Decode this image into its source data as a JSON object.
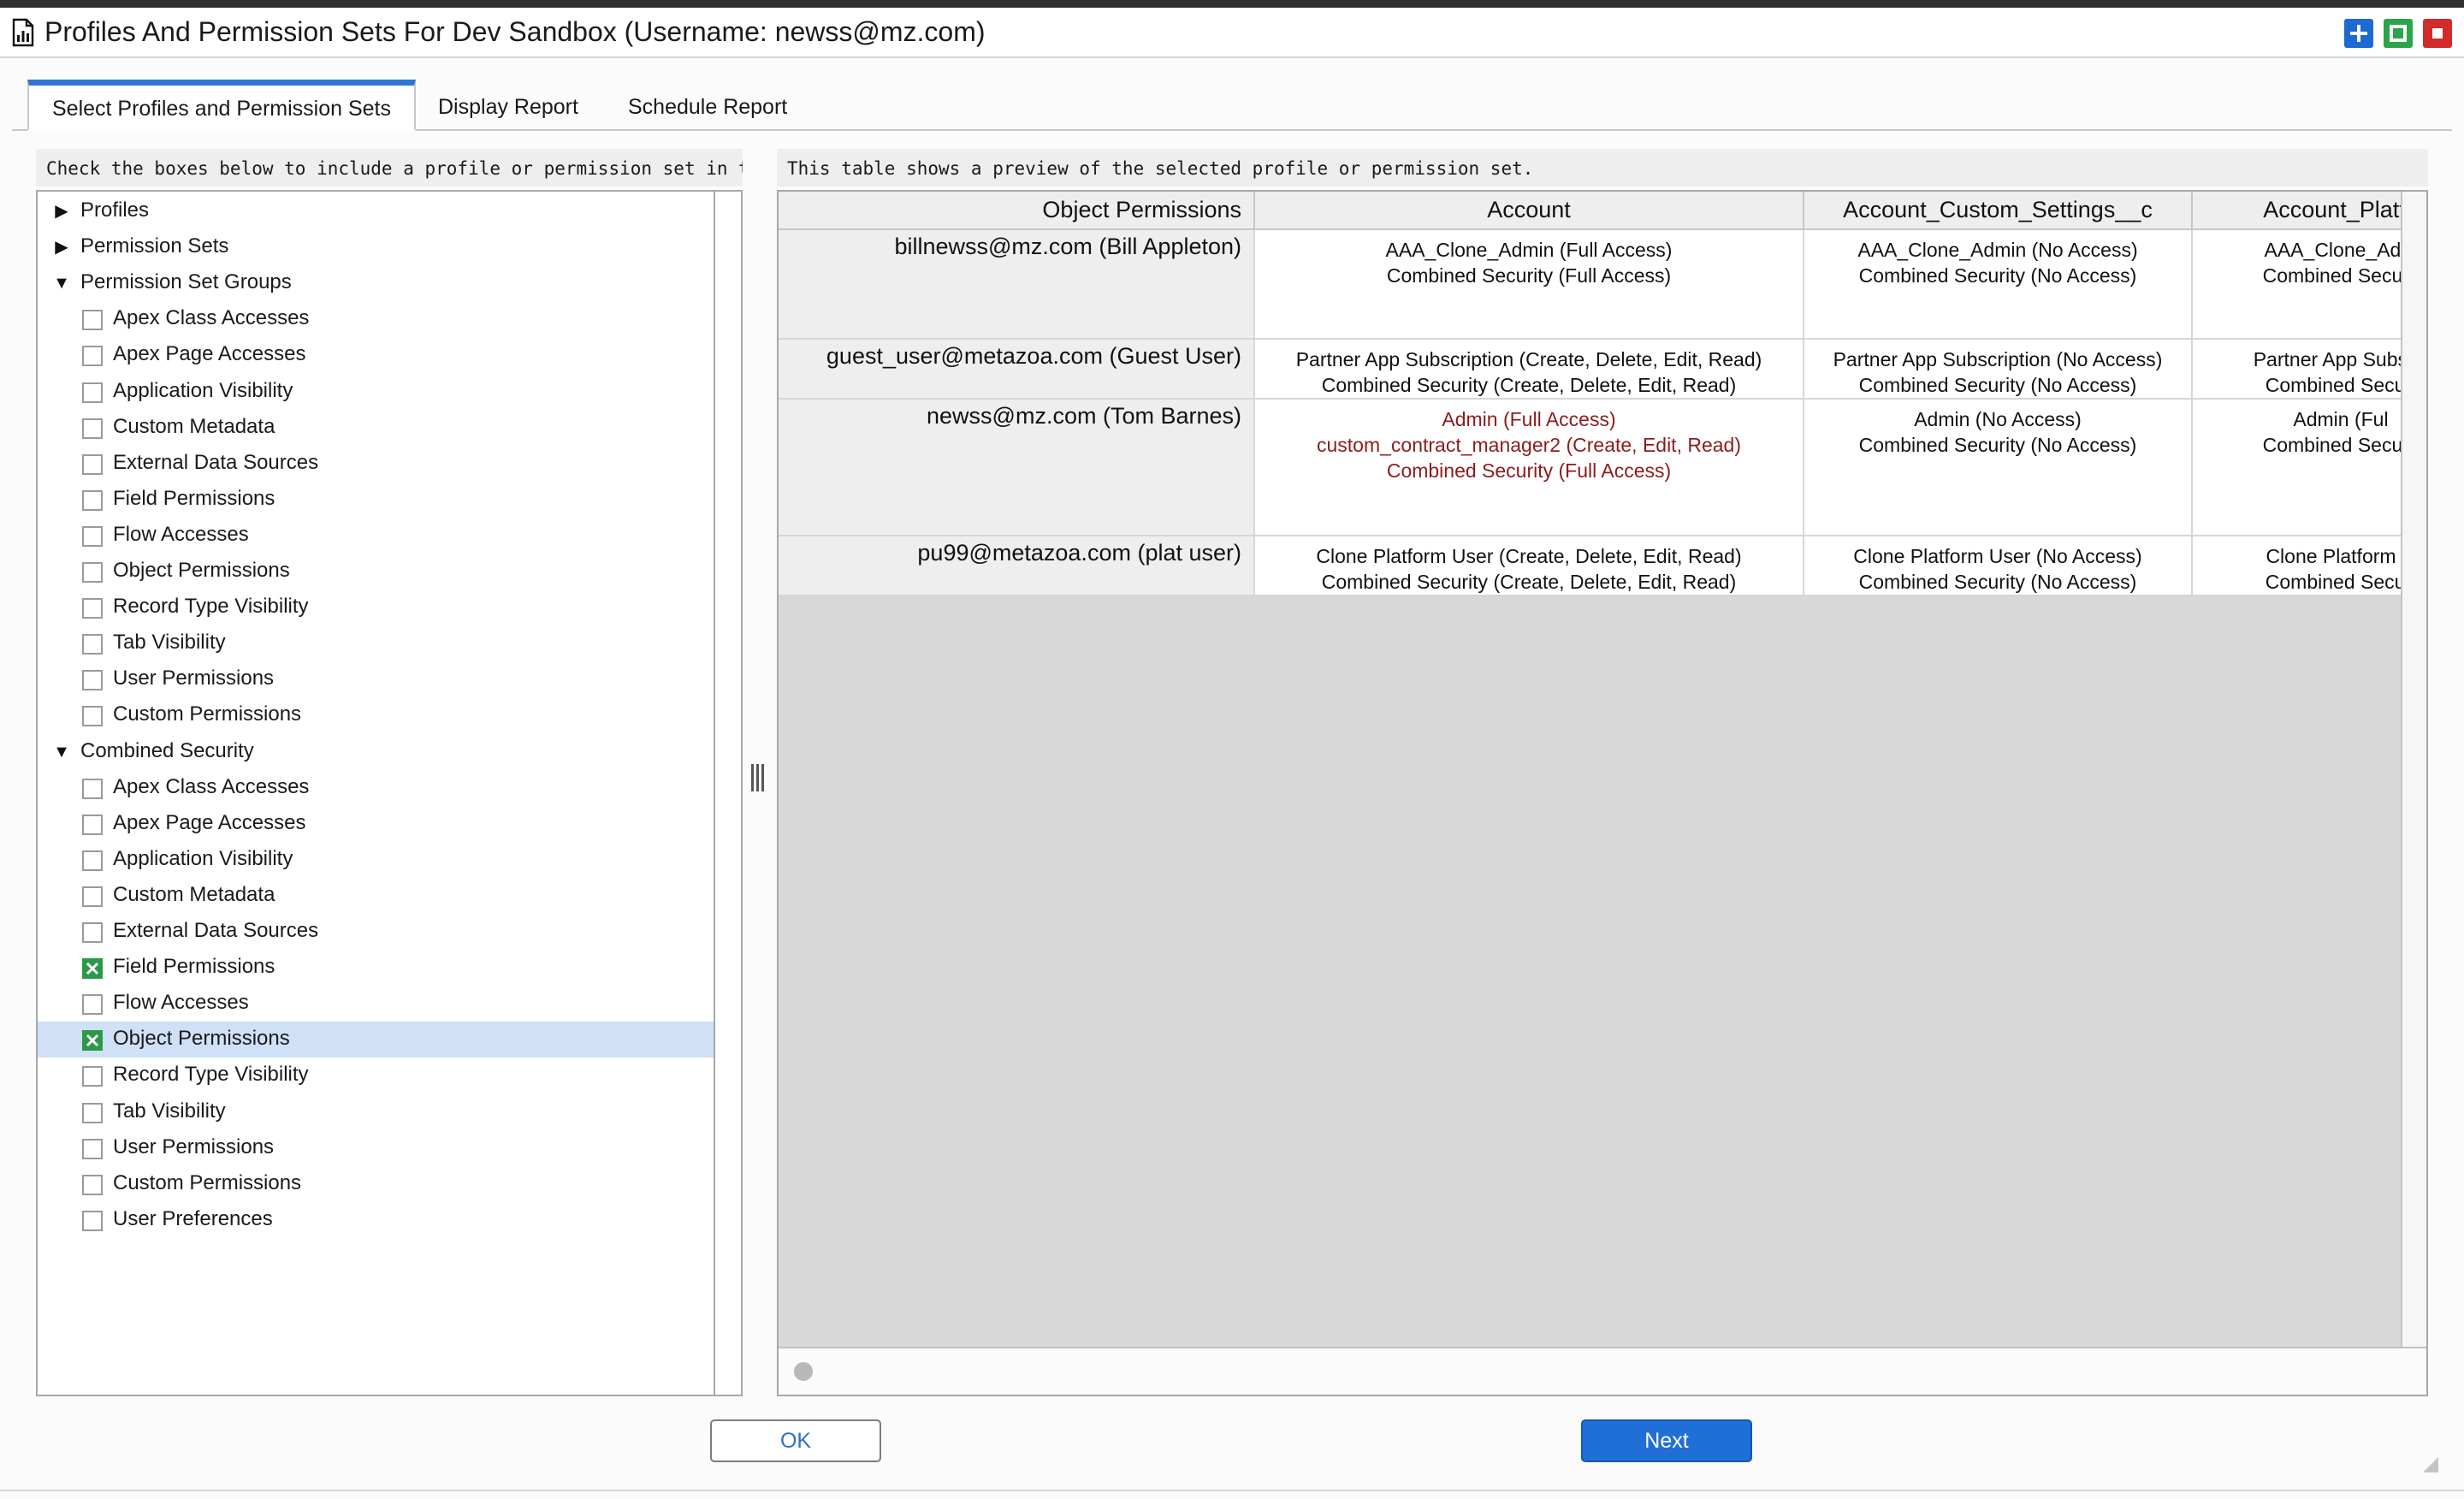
{
  "window": {
    "title": "Profiles And Permission Sets For Dev Sandbox (Username: newss@mz.com)",
    "icon": "report-icon",
    "controls": [
      "add-icon",
      "maximize-icon",
      "close-icon"
    ],
    "colors": {
      "add": "#1e6ad3",
      "maximize": "#2aa54a",
      "close": "#d22b2b"
    }
  },
  "tabs": [
    {
      "label": "Select Profiles and Permission Sets",
      "active": true
    },
    {
      "label": "Display Report",
      "active": false
    },
    {
      "label": "Schedule Report",
      "active": false
    }
  ],
  "left": {
    "hint": "Check the boxes below to include a profile or permission set in the repo",
    "tree": [
      {
        "label": "Profiles",
        "expanded": false
      },
      {
        "label": "Permission Sets",
        "expanded": false
      },
      {
        "label": "Permission Set Groups",
        "expanded": true,
        "children": [
          {
            "label": "Apex Class Accesses",
            "checked": false
          },
          {
            "label": "Apex Page Accesses",
            "checked": false
          },
          {
            "label": "Application Visibility",
            "checked": false
          },
          {
            "label": "Custom Metadata",
            "checked": false
          },
          {
            "label": "External Data Sources",
            "checked": false
          },
          {
            "label": "Field Permissions",
            "checked": false
          },
          {
            "label": "Flow Accesses",
            "checked": false
          },
          {
            "label": "Object Permissions",
            "checked": false
          },
          {
            "label": "Record Type Visibility",
            "checked": false
          },
          {
            "label": "Tab Visibility",
            "checked": false
          },
          {
            "label": "User Permissions",
            "checked": false
          },
          {
            "label": "Custom Permissions",
            "checked": false
          }
        ]
      },
      {
        "label": "Combined Security",
        "expanded": true,
        "children": [
          {
            "label": "Apex Class Accesses",
            "checked": false
          },
          {
            "label": "Apex Page Accesses",
            "checked": false
          },
          {
            "label": "Application Visibility",
            "checked": false
          },
          {
            "label": "Custom Metadata",
            "checked": false
          },
          {
            "label": "External Data Sources",
            "checked": false
          },
          {
            "label": "Field Permissions",
            "checked": true
          },
          {
            "label": "Flow Accesses",
            "checked": false
          },
          {
            "label": "Object Permissions",
            "checked": true,
            "selected": true
          },
          {
            "label": "Record Type Visibility",
            "checked": false
          },
          {
            "label": "Tab Visibility",
            "checked": false
          },
          {
            "label": "User Permissions",
            "checked": false
          },
          {
            "label": "Custom Permissions",
            "checked": false
          },
          {
            "label": "User Preferences",
            "checked": false
          }
        ]
      }
    ]
  },
  "right": {
    "hint": "This table shows a preview of the selected profile or permission set.",
    "table": {
      "columns": [
        "Object Permissions",
        "Account",
        "Account_Custom_Settings__c",
        "Account_Platfo"
      ],
      "rows": [
        {
          "user": "billnewss@mz.com (Bill Appleton)",
          "highlight": false,
          "cells": [
            [
              "AAA_Clone_Admin (Full Access)",
              "Combined Security (Full Access)"
            ],
            [
              "AAA_Clone_Admin (No Access)",
              "Combined Security (No Access)"
            ],
            [
              "AAA_Clone_Adm",
              "Combined Securit"
            ]
          ]
        },
        {
          "user": "guest_user@metazoa.com (Guest User)",
          "highlight": false,
          "cells": [
            [
              "Partner App Subscription (Create, Delete, Edit, Read)",
              "Combined Security (Create, Delete, Edit, Read)"
            ],
            [
              "Partner App Subscription (No Access)",
              "Combined Security (No Access)"
            ],
            [
              "Partner App Subscri",
              "Combined Securi"
            ]
          ]
        },
        {
          "user": "newss@mz.com (Tom Barnes)",
          "highlight": true,
          "cells": [
            [
              "Admin (Full Access)",
              "custom_contract_manager2 (Create, Edit, Read)",
              "Combined Security (Full Access)"
            ],
            [
              "Admin (No Access)",
              "Combined Security (No Access)"
            ],
            [
              "Admin (Ful",
              "Combined Securit"
            ]
          ]
        },
        {
          "user": "pu99@metazoa.com (plat user)",
          "highlight": false,
          "cells": [
            [
              "Clone Platform User (Create, Delete, Edit, Read)",
              "Combined Security (Create, Delete, Edit, Read)"
            ],
            [
              "Clone Platform User (No Access)",
              "Combined Security (No Access)"
            ],
            [
              "Clone Platform U",
              "Combined Securi"
            ]
          ]
        }
      ]
    }
  },
  "buttons": {
    "ok": "OK",
    "next": "Next"
  }
}
